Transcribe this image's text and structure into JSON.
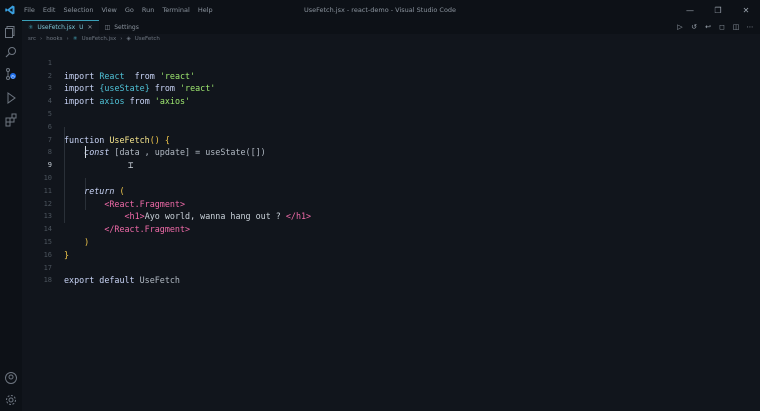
{
  "window": {
    "title": "UseFetch.jsx - react-demo - Visual Studio Code",
    "menu": [
      "File",
      "Edit",
      "Selection",
      "View",
      "Go",
      "Run",
      "Terminal",
      "Help"
    ]
  },
  "tabs": [
    {
      "label": "UseFetch.jsx",
      "status": "U",
      "active": true
    },
    {
      "label": "Settings",
      "active": false
    }
  ],
  "breadcrumb": [
    "src",
    "hooks",
    "UseFetch.jsx",
    "UseFetch"
  ],
  "editor": {
    "current_line": 9,
    "line_numbers": [
      "1",
      "2",
      "3",
      "4",
      "5",
      "6",
      "7",
      "8",
      "9",
      "10",
      "11",
      "12",
      "13",
      "14",
      "15",
      "16",
      "17",
      "18"
    ],
    "lines": {
      "l1": {
        "kw": "import",
        "ident": "React",
        "from": "from",
        "str": "'react'"
      },
      "l2": {
        "kw": "import",
        "ident": "{useState}",
        "from": "from",
        "str": "'react'"
      },
      "l3": {
        "kw": "import",
        "ident": "axios",
        "from": "from",
        "str": "'axios'"
      },
      "l6": {
        "kw": "function",
        "fn": "UseFetch",
        "rest": "() {"
      },
      "l7": {
        "kw": "const",
        "rest": " [data , update] = useState([])"
      },
      "l10": {
        "kw": "return",
        "rest": " ("
      },
      "l11": {
        "tag": "<React.Fragment>"
      },
      "l12": {
        "open": "<h1>",
        "text": "Ayo world, wanna hang out ? ",
        "close": "</h1>"
      },
      "l13": {
        "tag": "</React.Fragment>"
      },
      "l14": {
        "text": ")"
      },
      "l15": {
        "text": "}"
      },
      "l17": {
        "kw": "export default",
        "ident": "UseFetch"
      }
    }
  },
  "colors": {
    "background": "#11151c",
    "keyword": "#c8d3f5",
    "identifier": "#4fc1d6",
    "string": "#9fe870",
    "function": "#f6e58d",
    "jsx_tag": "#ef6aa8"
  }
}
